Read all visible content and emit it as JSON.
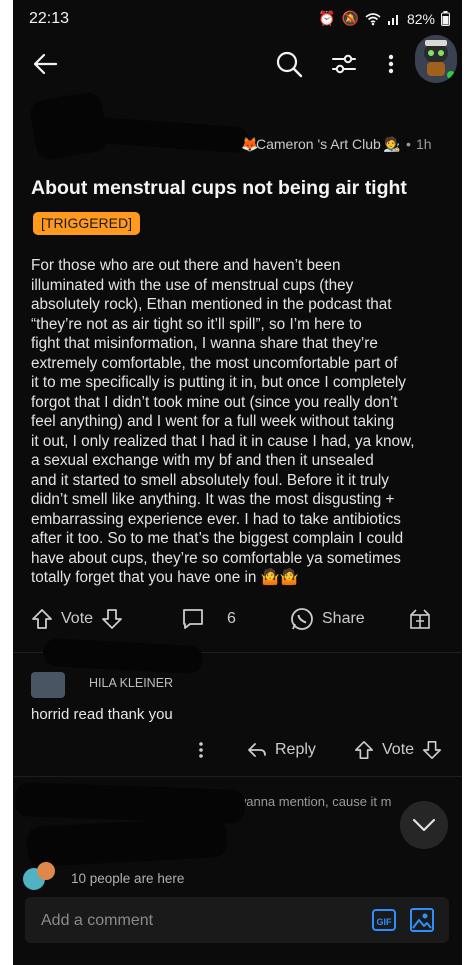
{
  "status": {
    "time": "22:13",
    "battery": "82%"
  },
  "topbar": {
    "back_icon": "arrow-left-icon",
    "search_icon": "search-icon",
    "filter_icon": "sliders-icon",
    "more_icon": "vertical-dots-icon"
  },
  "post": {
    "club": "Cameron 's Art Club",
    "age": "1h",
    "title": "About menstrual cups not being air tight",
    "flair": "[TRIGGERED]",
    "body_lines": [
      "For those who are out there and haven’t been",
      "illuminated with the use of menstrual cups (they",
      "absolutely rock), Ethan mentioned in the podcast that",
      "“they’re not as air tight so it’ll spill”, so I’m here to",
      "fight that misinformation, I wanna share that they’re",
      "extremely comfortable, the most uncomfortable part of",
      "it to me specifically is putting it in, but once I completely",
      "forgot that I didn’t took mine out (since you really don’t",
      "feel anything) and I went for a full week without taking",
      "it out, I only realized that I had it in cause I had, ya know,",
      "a sexual exchange with my bf and then it unsealed",
      "and it started to smell absolutely foul. Before it it truly",
      "didn’t smell like anything. It was the most disgusting +",
      "embarrassing experience ever. I had to take antibiotics",
      "after it too. So to me that’s the biggest complain I could",
      "have about cups, they’re so comfortable ya sometimes",
      "totally forget that you have one in 🤷🤷"
    ],
    "vote_label": "Vote",
    "comment_count": "6",
    "share_label": "Share"
  },
  "comments": [
    {
      "author": "HILA KLEINER",
      "text": "horrid read thank you",
      "reply_label": "Reply",
      "vote_label": "Vote"
    },
    {
      "text_fragment": "just wanna mention, cause it m"
    }
  ],
  "footer": {
    "people_text": "10 people are here",
    "comment_placeholder": "Add a comment",
    "gif_label": "GIF"
  },
  "colors": {
    "background": "#0b0b0b",
    "flair": "#ff9a1f",
    "accent": "#2f8fff",
    "text": "#e3e3e3"
  }
}
